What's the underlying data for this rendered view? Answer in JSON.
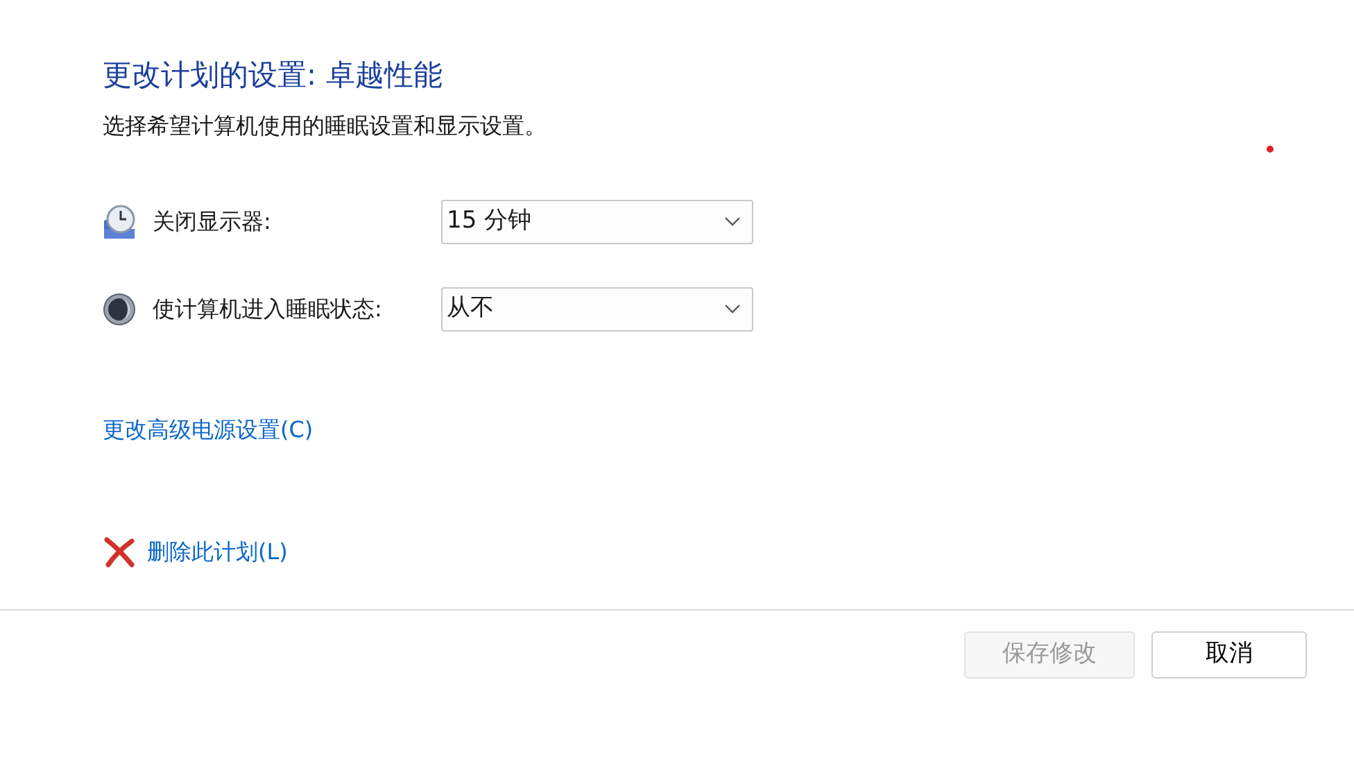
{
  "title": "更改计划的设置: 卓越性能",
  "subtitle": "选择希望计算机使用的睡眠设置和显示设置。",
  "settings": [
    {
      "kind": "display",
      "label": "关闭显示器:",
      "value": "15 分钟"
    },
    {
      "kind": "sleep",
      "label": "使计算机进入睡眠状态:",
      "value": "从不"
    }
  ],
  "advanced_link": "更改高级电源设置(C)",
  "delete_link": "删除此计划(L)",
  "buttons": [
    {
      "label": "保存修改",
      "disabled": true
    },
    {
      "label": "取消",
      "disabled": false
    }
  ]
}
